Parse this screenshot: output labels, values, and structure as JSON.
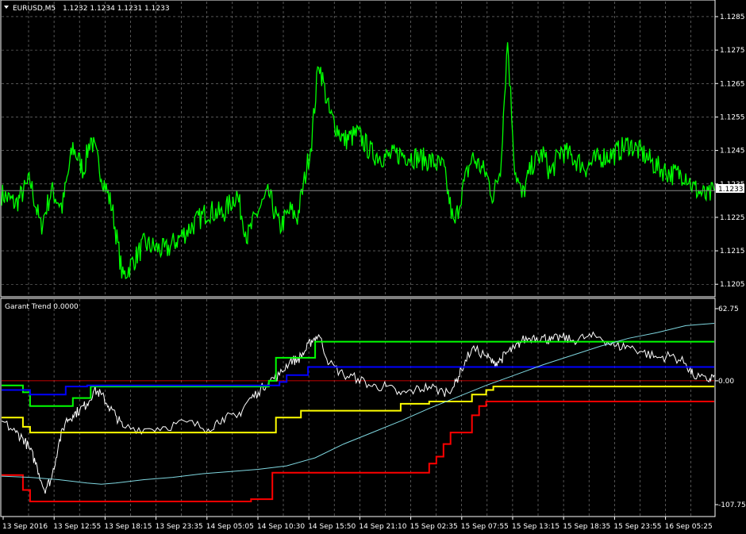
{
  "header": {
    "symbol": "EURUSD,M5",
    "ohlc": "1.1232 1.1234 1.1231 1.1233"
  },
  "indicator": {
    "title": "Garant Trend 0.0000"
  },
  "price_axis": {
    "ticks": [
      "1.1285",
      "1.1275",
      "1.1265",
      "1.1255",
      "1.1245",
      "1.1235",
      "1.1225",
      "1.1215",
      "1.1205"
    ],
    "current": "1.1233"
  },
  "indicator_axis": {
    "ticks": [
      "62.75",
      "0.00",
      "-107.75"
    ]
  },
  "time_axis": {
    "labels": [
      "13 Sep 2016",
      "13 Sep 12:55",
      "13 Sep 18:15",
      "13 Sep 23:35",
      "14 Sep 05:05",
      "14 Sep 10:30",
      "14 Sep 15:50",
      "14 Sep 21:10",
      "15 Sep 02:35",
      "15 Sep 07:55",
      "15 Sep 13:15",
      "15 Sep 18:35",
      "15 Sep 23:55",
      "16 Sep 05:25"
    ]
  },
  "colors": {
    "background": "#000000",
    "grid": "#8a8a8a",
    "price": "#00ff00",
    "white": "#ffffff",
    "green": "#00ff00",
    "blue": "#0000ff",
    "yellow": "#ffff00",
    "red": "#ff0000",
    "cyan": "#7fd7e0",
    "zero": "#ff0000"
  },
  "chart_data": [
    {
      "type": "line",
      "title": "EURUSD,M5",
      "ylim": [
        1.12015,
        1.12895
      ],
      "series": [
        {
          "x": [
            0,
            0.02,
            0.04,
            0.055,
            0.07,
            0.085,
            0.1,
            0.115,
            0.125,
            0.14,
            0.155,
            0.17,
            0.2,
            0.23,
            0.26,
            0.29,
            0.31,
            0.33,
            0.345,
            0.36,
            0.375,
            0.39,
            0.405,
            0.415,
            0.425,
            0.435,
            0.445,
            0.46,
            0.48,
            0.5,
            0.52,
            0.54,
            0.56,
            0.58,
            0.6,
            0.62,
            0.635,
            0.645,
            0.66,
            0.68,
            0.69,
            0.7,
            0.71,
            0.72,
            0.73,
            0.745,
            0.76,
            0.77,
            0.785,
            0.8,
            0.82,
            0.84,
            0.86,
            0.88,
            0.9,
            0.92,
            0.94,
            0.96,
            0.97,
            0.99,
            1
          ],
          "values": [
            1.1232,
            1.1229,
            1.1236,
            1.1222,
            1.1233,
            1.1228,
            1.1246,
            1.1239,
            1.1249,
            1.1238,
            1.1228,
            1.1207,
            1.1217,
            1.1215,
            1.1221,
            1.1227,
            1.1226,
            1.1232,
            1.1219,
            1.1227,
            1.1232,
            1.1222,
            1.1227,
            1.1225,
            1.1236,
            1.1248,
            1.1272,
            1.1256,
            1.1248,
            1.125,
            1.1244,
            1.1243,
            1.1244,
            1.1243,
            1.1242,
            1.124,
            1.1222,
            1.1232,
            1.1243,
            1.1238,
            1.1231,
            1.124,
            1.1278,
            1.124,
            1.1231,
            1.1241,
            1.1244,
            1.1238,
            1.1245,
            1.1243,
            1.124,
            1.1243,
            1.1244,
            1.1247,
            1.1244,
            1.124,
            1.1238,
            1.1238,
            1.1234,
            1.1231,
            1.1233
          ]
        }
      ]
    },
    {
      "type": "line",
      "title": "Garant Trend 0.0000",
      "ylim": [
        -107.75,
        62.75
      ],
      "series": [
        {
          "color": "white",
          "x": [
            0,
            0.02,
            0.03,
            0.04,
            0.05,
            0.06,
            0.07,
            0.08,
            0.09,
            0.1,
            0.11,
            0.12,
            0.13,
            0.14,
            0.15,
            0.16,
            0.17,
            0.2,
            0.23,
            0.26,
            0.29,
            0.31,
            0.33,
            0.345,
            0.36,
            0.375,
            0.39,
            0.405,
            0.415,
            0.425,
            0.435,
            0.445,
            0.46,
            0.48,
            0.5,
            0.52,
            0.54,
            0.56,
            0.58,
            0.6,
            0.62,
            0.635,
            0.645,
            0.66,
            0.68,
            0.69,
            0.7,
            0.71,
            0.72,
            0.73,
            0.745,
            0.76,
            0.77,
            0.785,
            0.8,
            0.82,
            0.84,
            0.86,
            0.88,
            0.9,
            0.92,
            0.94,
            0.96,
            0.97,
            0.99,
            1
          ],
          "values": [
            -35,
            -45,
            -50,
            -60,
            -75,
            -95,
            -85,
            -55,
            -35,
            -30,
            -25,
            -20,
            -8,
            -12,
            -22,
            -30,
            -40,
            -42,
            -40,
            -36,
            -42,
            -32,
            -32,
            -18,
            -10,
            0,
            5,
            18,
            18,
            25,
            35,
            40,
            15,
            5,
            2,
            -5,
            -5,
            -12,
            -8,
            -5,
            -10,
            -5,
            10,
            28,
            22,
            15,
            18,
            25,
            28,
            35,
            38,
            38,
            35,
            38,
            35,
            38,
            38,
            30,
            30,
            25,
            20,
            22,
            15,
            5,
            0,
            5
          ]
        },
        {
          "color": "green",
          "x": [
            0,
            0.02,
            0.03,
            0.04,
            0.06,
            0.07,
            0.1,
            0.11,
            0.125,
            0.36,
            0.375,
            0.385,
            0.4,
            0.43,
            0.44,
            0.45,
            0.46,
            0.48,
            0.5,
            0.52,
            0.54,
            0.56,
            0.58,
            0.6,
            0.62,
            0.64,
            0.66,
            0.72,
            0.74,
            0.76,
            0.78,
            0.8,
            0.82,
            0.84,
            0.86,
            0.88,
            0.9,
            0.92,
            0.94,
            0.96,
            0.98,
            1
          ],
          "values": [
            -4,
            -4,
            -10,
            -22,
            -22,
            -22,
            -15,
            -15,
            -5,
            -5,
            0,
            20,
            20,
            20,
            34,
            34,
            34,
            34,
            34,
            34,
            34,
            34,
            34,
            34,
            34,
            34,
            34,
            34,
            34,
            34,
            34,
            34,
            34,
            34,
            34,
            34,
            34,
            34,
            34,
            34,
            34,
            34
          ]
        },
        {
          "color": "blue",
          "x": [
            0,
            0.03,
            0.04,
            0.07,
            0.09,
            0.1,
            0.11,
            0.12,
            0.385,
            0.39,
            0.4,
            0.41,
            0.43,
            0.44,
            0.45,
            0.46,
            0.48,
            0.5,
            0.52,
            0.54,
            0.56,
            0.58,
            0.6,
            0.62,
            0.64,
            0.66,
            0.68,
            0.7,
            0.72,
            0.74,
            0.76,
            0.78,
            0.8,
            0.82,
            0.84,
            0.86,
            0.88,
            0.9,
            0.92,
            0.94,
            0.96,
            0.98,
            1
          ],
          "values": [
            -8,
            -8,
            -12,
            -12,
            -5,
            -5,
            -5,
            -4,
            -4,
            -1,
            5,
            5,
            12,
            12,
            12,
            12,
            12,
            12,
            12,
            12,
            12,
            12,
            12,
            12,
            12,
            12,
            12,
            12,
            12,
            12,
            12,
            12,
            12,
            12,
            12,
            12,
            12,
            12,
            12,
            12,
            12,
            12,
            12
          ]
        },
        {
          "color": "yellow",
          "x": [
            0,
            0.02,
            0.03,
            0.04,
            0.13,
            0.375,
            0.385,
            0.4,
            0.42,
            0.43,
            0.44,
            0.46,
            0.48,
            0.5,
            0.52,
            0.54,
            0.56,
            0.58,
            0.6,
            0.62,
            0.64,
            0.655,
            0.66,
            0.67,
            0.68,
            0.69,
            0.7,
            0.72,
            0.74,
            0.76,
            0.78,
            0.8,
            0.82,
            0.84,
            0.86,
            0.88,
            0.9,
            0.92,
            0.94,
            0.96,
            0.98,
            1
          ],
          "values": [
            -32,
            -32,
            -40,
            -45,
            -45,
            -45,
            -32,
            -32,
            -26,
            -26,
            -26,
            -26,
            -26,
            -26,
            -26,
            -26,
            -20,
            -20,
            -18,
            -18,
            -18,
            -18,
            -12,
            -12,
            -8,
            -5,
            -5,
            -5,
            -5,
            -5,
            -5,
            -5,
            -5,
            -5,
            -5,
            -5,
            -5,
            -5,
            -5,
            -5,
            -5,
            -5
          ]
        },
        {
          "color": "red",
          "x": [
            0,
            0.02,
            0.03,
            0.04,
            0.14,
            0.34,
            0.35,
            0.375,
            0.38,
            0.39,
            0.4,
            0.41,
            0.59,
            0.6,
            0.61,
            0.62,
            0.63,
            0.64,
            0.66,
            0.67,
            0.68,
            0.69,
            0.7,
            0.72,
            0.74,
            0.76,
            0.78,
            0.8,
            0.82,
            0.84,
            0.86,
            0.88,
            0.9,
            0.92,
            0.94,
            0.96,
            0.98,
            1
          ],
          "values": [
            -82,
            -82,
            -95,
            -105,
            -105,
            -105,
            -103,
            -103,
            -80,
            -80,
            -80,
            -80,
            -80,
            -72,
            -66,
            -55,
            -45,
            -45,
            -30,
            -22,
            -18,
            -18,
            -18,
            -18,
            -18,
            -18,
            -18,
            -18,
            -18,
            -18,
            -18,
            -18,
            -18,
            -18,
            -18,
            -18,
            -18,
            -18
          ]
        },
        {
          "color": "cyan",
          "x": [
            0,
            0.04,
            0.08,
            0.12,
            0.14,
            0.16,
            0.2,
            0.24,
            0.28,
            0.32,
            0.36,
            0.4,
            0.44,
            0.48,
            0.52,
            0.56,
            0.6,
            0.64,
            0.68,
            0.72,
            0.76,
            0.8,
            0.84,
            0.88,
            0.92,
            0.96,
            1
          ],
          "values": [
            -83,
            -84,
            -86,
            -89,
            -90,
            -89,
            -86,
            -84,
            -81,
            -79,
            -77,
            -74,
            -67,
            -55,
            -45,
            -35,
            -24,
            -14,
            -4,
            5,
            14,
            22,
            30,
            37,
            42,
            48,
            50
          ]
        }
      ]
    }
  ]
}
